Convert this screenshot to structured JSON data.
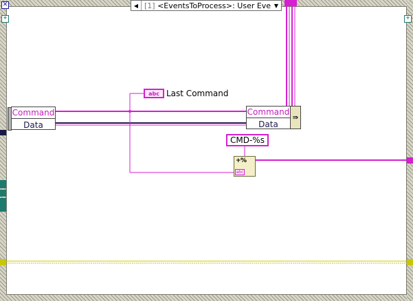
{
  "event_case": {
    "selector_index": "[1]",
    "selector_label": "<EventsToProcess>: User Event",
    "prev_arrow": "◀",
    "next_arrow": "▼"
  },
  "unbundle": {
    "fields": [
      "Command",
      "Data"
    ]
  },
  "bundle": {
    "fields": [
      "Command",
      "Data"
    ]
  },
  "indicator": {
    "type_tag": "abc",
    "label": "Last Command"
  },
  "format_constant": {
    "value": "CMD-%s"
  },
  "format_node": {
    "glyph": "+%",
    "type_tag": "abc"
  },
  "colors": {
    "string_wire": "#d51fd0",
    "cluster_wire": "#1a1a48",
    "refnum_wire": "#c8c800",
    "frame": "#d8d6c8",
    "tunnel_teal": "#1e7a6e"
  },
  "icons": {
    "top_left": "stop-icon",
    "inner_left": "event-data-node-icon",
    "inner_right": "event-timeout-icon"
  }
}
